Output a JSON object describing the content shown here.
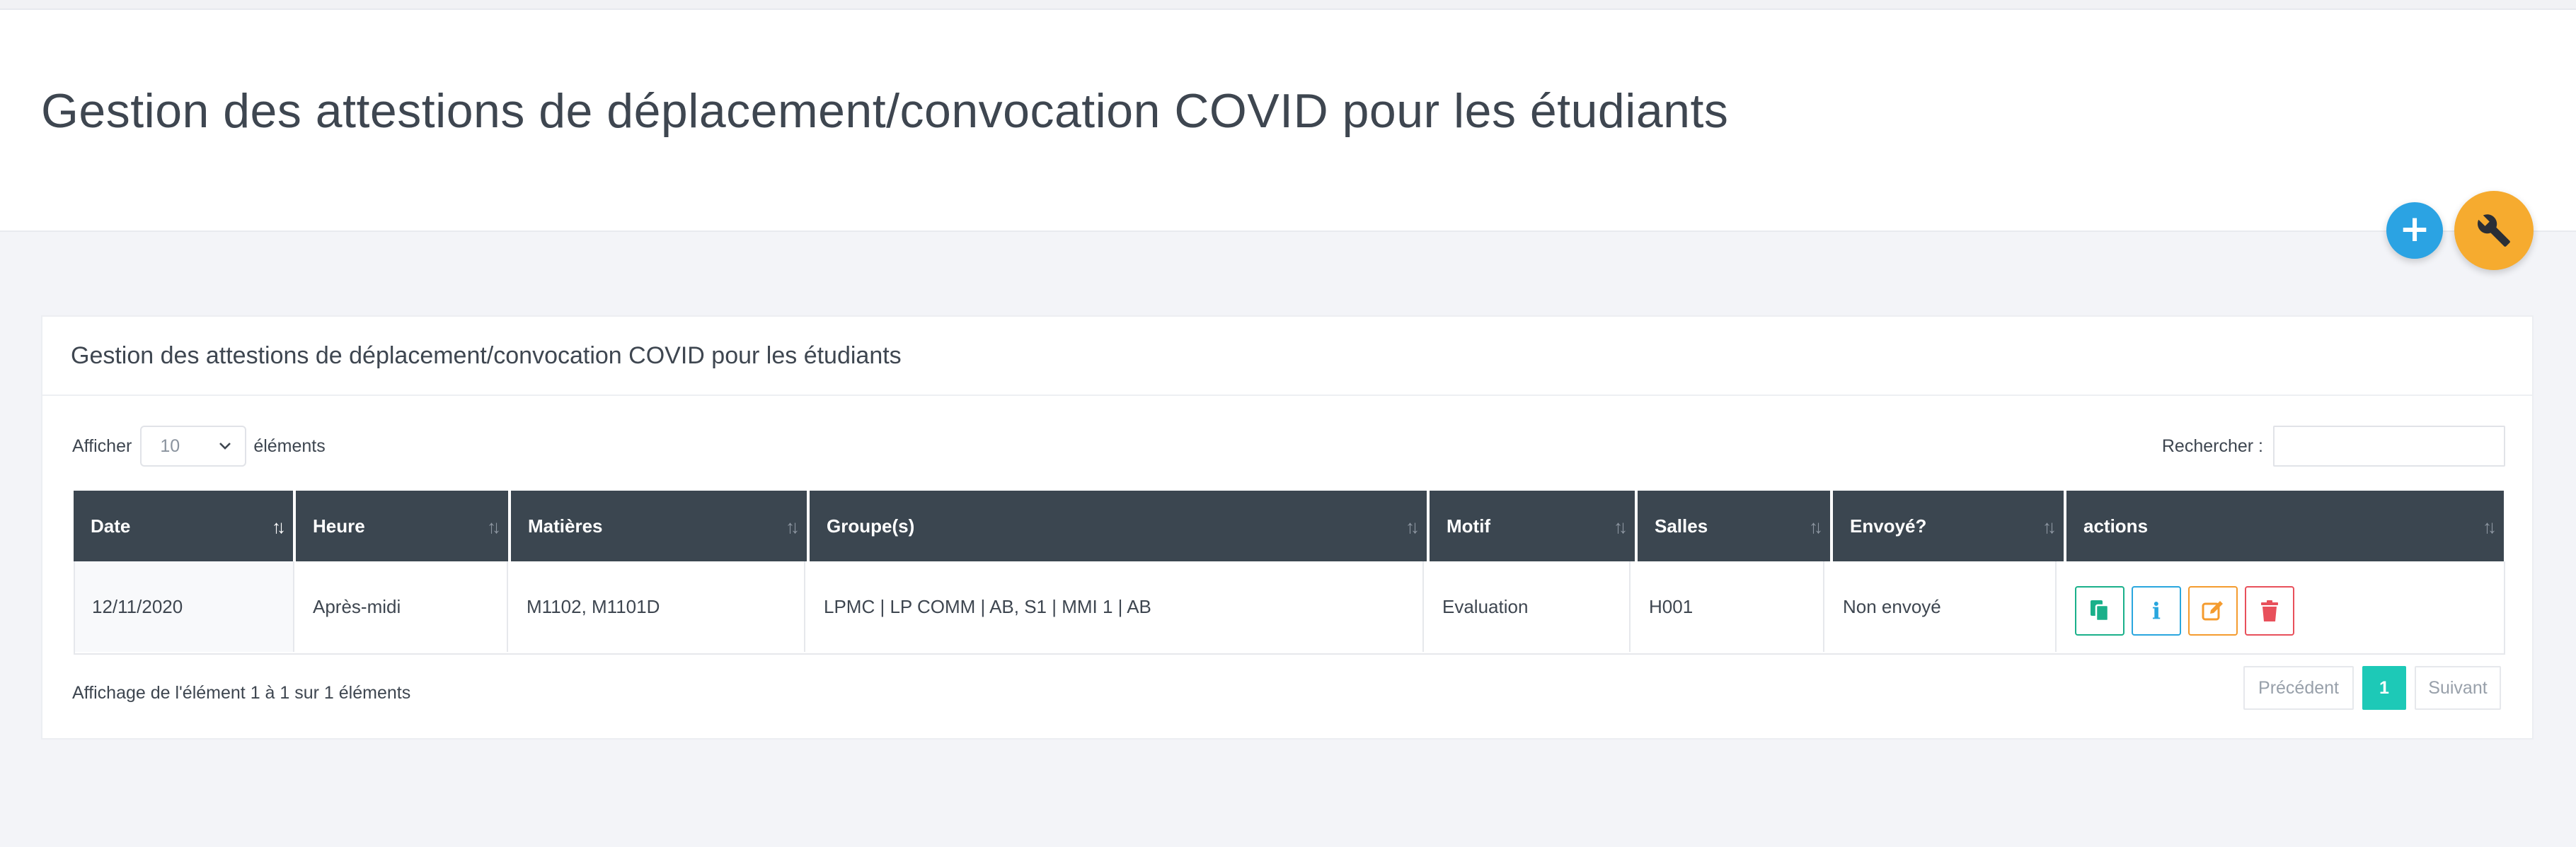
{
  "header": {
    "title": "Gestion des attestions de déplacement/convocation COVID pour les étudiants"
  },
  "fab": {
    "add_label": "+",
    "tools_icon": "wrench-icon"
  },
  "card": {
    "title": "Gestion des attestions de déplacement/convocation COVID pour les étudiants"
  },
  "length": {
    "prefix": "Afficher",
    "value": "10",
    "suffix": "éléments"
  },
  "search": {
    "label": "Rechercher :",
    "value": ""
  },
  "table": {
    "columns": [
      "Date",
      "Heure",
      "Matières",
      "Groupe(s)",
      "Motif",
      "Salles",
      "Envoyé?",
      "actions"
    ],
    "sorted_column": "Date",
    "rows": [
      {
        "date": "12/11/2020",
        "heure": "Après-midi",
        "matieres": "M1102, M1101D",
        "groupes": "LPMC | LP COMM | AB, S1 | MMI 1 | AB",
        "motif": "Evaluation",
        "salles": "H001",
        "envoye": "Non envoyé",
        "actions": [
          "copy-icon",
          "info-icon",
          "edit-icon",
          "trash-icon"
        ]
      }
    ]
  },
  "footer": {
    "info": "Affichage de l'élément 1 à 1 sur 1 éléments",
    "prev": "Précédent",
    "page": "1",
    "next": "Suivant"
  },
  "colors": {
    "accent_teal": "#1dc9b7",
    "fab_blue": "#2ba3e3",
    "fab_orange": "#f6ab2f",
    "header_dark": "#3b4650",
    "copy_green": "#1ab08a",
    "info_blue": "#29a6de",
    "edit_orange": "#f49b2e",
    "delete_red": "#e8505b"
  }
}
